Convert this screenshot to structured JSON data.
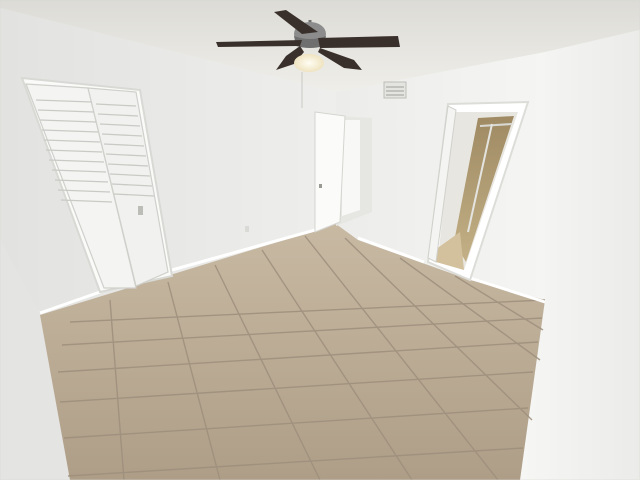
{
  "scene": {
    "kind": "photo",
    "subject": "empty-bedroom",
    "colors": {
      "ceiling": "#ecebe7",
      "wall_left": "#eeeeec",
      "wall_back": "#f2f2f0",
      "wall_right": "#f4f4f2",
      "floor": "#b9a993",
      "grout": "#9d8f7c",
      "trim": "#ffffff",
      "fan_blade": "#3a302b",
      "fan_motor": "#8c8c8c",
      "light": "#fff6dc",
      "bathroom_tile": "#b8a47e"
    },
    "objects": [
      "ceiling-fan",
      "bifold-closet-doors",
      "open-hallway-door",
      "bathroom-doorway",
      "air-vent",
      "tile-floor",
      "baseboards"
    ]
  }
}
